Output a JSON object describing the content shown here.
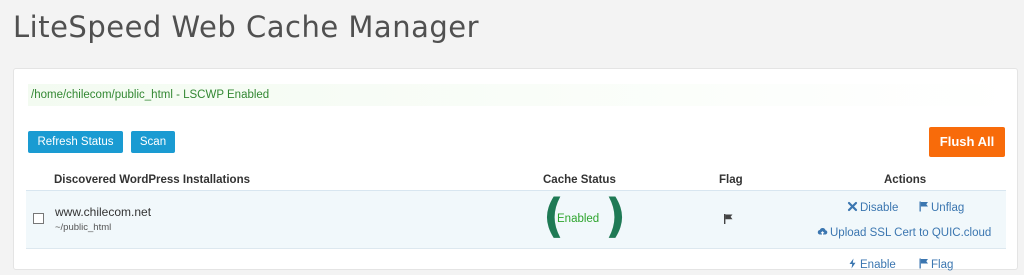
{
  "page": {
    "title": "LiteSpeed Web Cache Manager"
  },
  "path_bar": {
    "text": "/home/chilecom/public_html - LSCWP Enabled"
  },
  "toolbar": {
    "refresh_label": "Refresh Status",
    "scan_label": "Scan",
    "flush_label": "Flush All"
  },
  "table": {
    "headers": {
      "installations": "Discovered WordPress Installations",
      "cache_status": "Cache Status",
      "flag": "Flag",
      "actions": "Actions"
    },
    "rows": [
      {
        "site": "www.chilecom.net",
        "path": "~/public_html",
        "cache_status": "Enabled",
        "flag_icon": "flag-icon",
        "actions": {
          "disable": "Disable",
          "unflag": "Unflag",
          "ssl": "Upload SSL Cert to QUIC.cloud"
        }
      },
      {
        "actions": {
          "enable": "Enable",
          "flag": "Flag"
        }
      }
    ]
  },
  "colors": {
    "primary": "#1a9bd2",
    "flush": "#f86b0a",
    "enabled_text": "#2ea52e",
    "status_bracket": "#1f7a55",
    "link": "#3b76b0",
    "path_text": "#338833"
  }
}
